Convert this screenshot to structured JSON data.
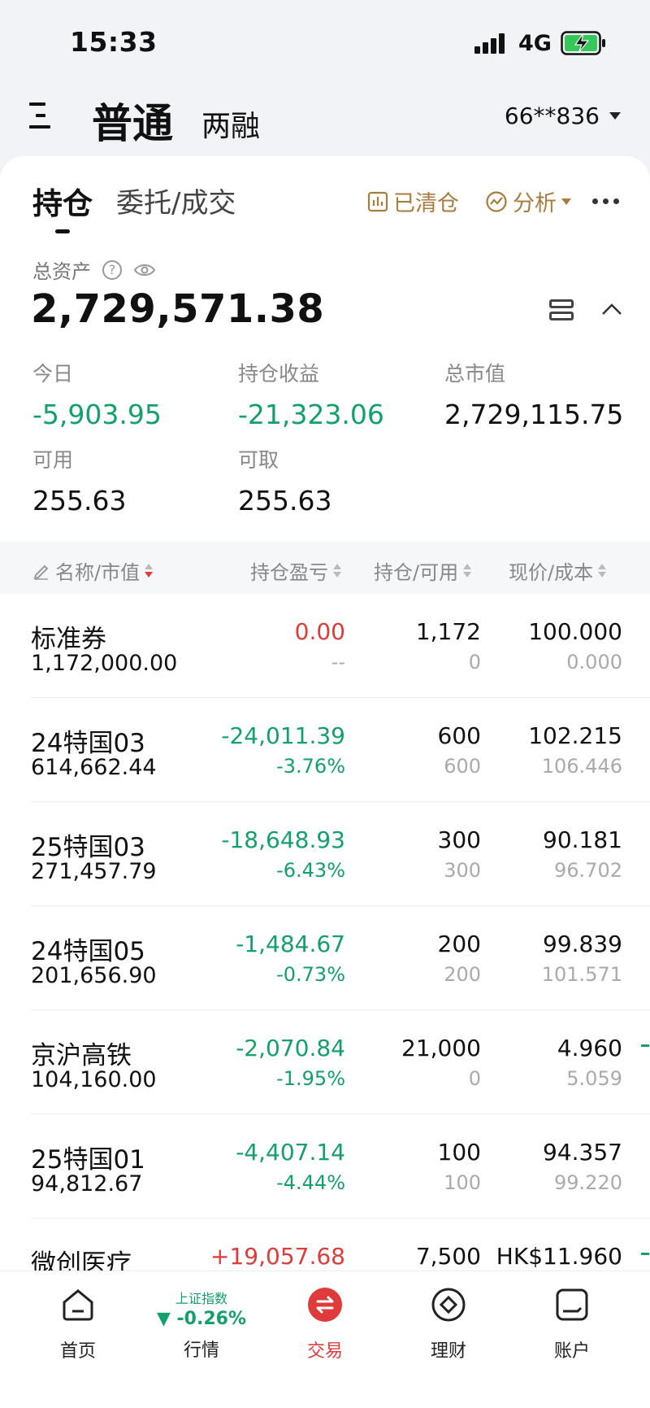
{
  "status_bar": {
    "time": "15:33",
    "network": "4G"
  },
  "header": {
    "tab_primary": "普通",
    "tab_secondary": "两融",
    "account": "66**836"
  },
  "card": {
    "tab_holdings": "持仓",
    "tab_orders": "委托/成交",
    "cleared_label": "已清仓",
    "analysis_label": "分析"
  },
  "summary": {
    "total_assets_label": "总资产",
    "total_assets": "2,729,571.38",
    "today_label": "今日",
    "today_value": "-5,903.95",
    "holding_pnl_label": "持仓收益",
    "holding_pnl_value": "-21,323.06",
    "market_value_label": "总市值",
    "market_value": "2,729,115.75",
    "available_label": "可用",
    "available_value": "255.63",
    "withdrawable_label": "可取",
    "withdrawable_value": "255.63"
  },
  "table": {
    "headers": [
      "名称/市值",
      "持仓盈亏",
      "持仓/可用",
      "现价/成本"
    ],
    "rows": [
      {
        "name": "标准券",
        "market_value": "1,172,000.00",
        "pnl": "0.00",
        "pnl_pct": "--",
        "qty": "1,172",
        "available": "0",
        "price": "100.000",
        "cost": "0.000",
        "color": "red"
      },
      {
        "name": "24特国03",
        "market_value": "614,662.44",
        "pnl": "-24,011.39",
        "pnl_pct": "-3.76%",
        "qty": "600",
        "available": "600",
        "price": "102.215",
        "cost": "106.446",
        "color": "green"
      },
      {
        "name": "25特国03",
        "market_value": "271,457.79",
        "pnl": "-18,648.93",
        "pnl_pct": "-6.43%",
        "qty": "300",
        "available": "300",
        "price": "90.181",
        "cost": "96.702",
        "color": "green"
      },
      {
        "name": "24特国05",
        "market_value": "201,656.90",
        "pnl": "-1,484.67",
        "pnl_pct": "-0.73%",
        "qty": "200",
        "available": "200",
        "price": "99.839",
        "cost": "101.571",
        "color": "green"
      },
      {
        "name": "京沪高铁",
        "market_value": "104,160.00",
        "pnl": "-2,070.84",
        "pnl_pct": "-1.95%",
        "qty": "21,000",
        "available": "0",
        "price": "4.960",
        "cost": "5.059",
        "color": "green"
      },
      {
        "name": "25特国01",
        "market_value": "94,812.67",
        "pnl": "-4,407.14",
        "pnl_pct": "-4.44%",
        "qty": "100",
        "available": "100",
        "price": "94.357",
        "cost": "99.220",
        "color": "green"
      },
      {
        "name": "微创医疗",
        "market_value": "",
        "pnl": "+19,057.68",
        "pnl_pct": "",
        "qty": "7,500",
        "available": "",
        "price": "HK$11.960",
        "cost": "",
        "color": "red"
      }
    ]
  },
  "bottom_nav": {
    "home": "首页",
    "market": "行情",
    "index_name": "上证指数",
    "index_change": "▼ -0.26%",
    "trade": "交易",
    "wealth": "理财",
    "account": "账户"
  },
  "colors": {
    "up": "#e03b3b",
    "down": "#13a06b",
    "accent": "#a97c3e"
  }
}
